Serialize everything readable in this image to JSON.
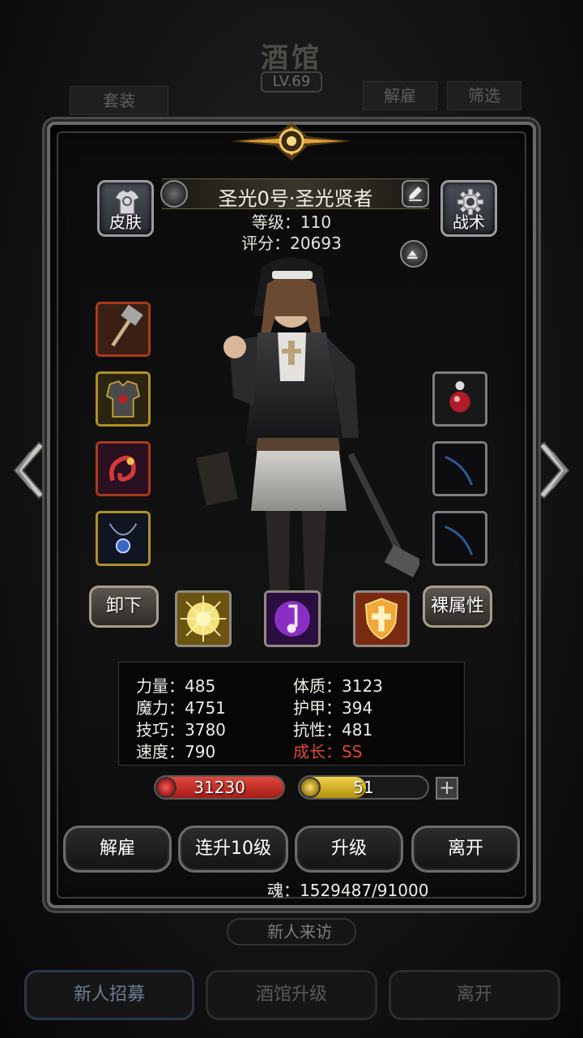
{
  "background": {
    "title": "酒馆",
    "level": "LV.69",
    "suit_button": "套装",
    "dismiss_button": "解雇",
    "filter_button": "筛选",
    "visit_button": "新人来访",
    "recruit_button": "新人招募",
    "upgrade_button": "酒馆升级",
    "leave_button": "离开"
  },
  "hero": {
    "name": "圣光0号·圣光贤者",
    "level_text": "等级：110",
    "score_text": "评分：20693"
  },
  "top_buttons": {
    "skin": "皮肤",
    "tactics": "战术"
  },
  "equipment_buttons": {
    "unequip": "卸下",
    "naked_attrs": "裸属性"
  },
  "equipment": {
    "left": [
      {
        "icon": "hammer-icon",
        "rarity": "red"
      },
      {
        "icon": "armor-icon",
        "rarity": "gold"
      },
      {
        "icon": "dragon-icon",
        "rarity": "red"
      },
      {
        "icon": "amulet-icon",
        "rarity": "gold"
      }
    ],
    "right": [
      {
        "icon": "orb-icon",
        "rarity": "gray"
      },
      {
        "icon": "empty-slot-icon",
        "rarity": "gray"
      },
      {
        "icon": "empty-slot-icon",
        "rarity": "gray"
      }
    ]
  },
  "skills": [
    {
      "icon": "holy-burst-icon"
    },
    {
      "icon": "music-note-icon"
    },
    {
      "icon": "holy-shield-icon"
    }
  ],
  "attributes": {
    "strength": "力量：485",
    "constitution": "体质：3123",
    "magic": "魔力：4751",
    "armor": "护甲：394",
    "skill": "技巧：3780",
    "resistance": "抗性：481",
    "speed": "速度：790",
    "growth": "成长：SS"
  },
  "bars": {
    "hp": "31230",
    "energy": "51",
    "plus": "+"
  },
  "actions": {
    "dismiss": "解雇",
    "level_up_10": "连升10级",
    "level_up": "升级",
    "leave": "离开"
  },
  "soul_text": "魂：1529487/91000",
  "colors": {
    "hp_bar": "#c42a22",
    "energy_bar": "#d6b21a",
    "growth_text": "#e2462d"
  }
}
